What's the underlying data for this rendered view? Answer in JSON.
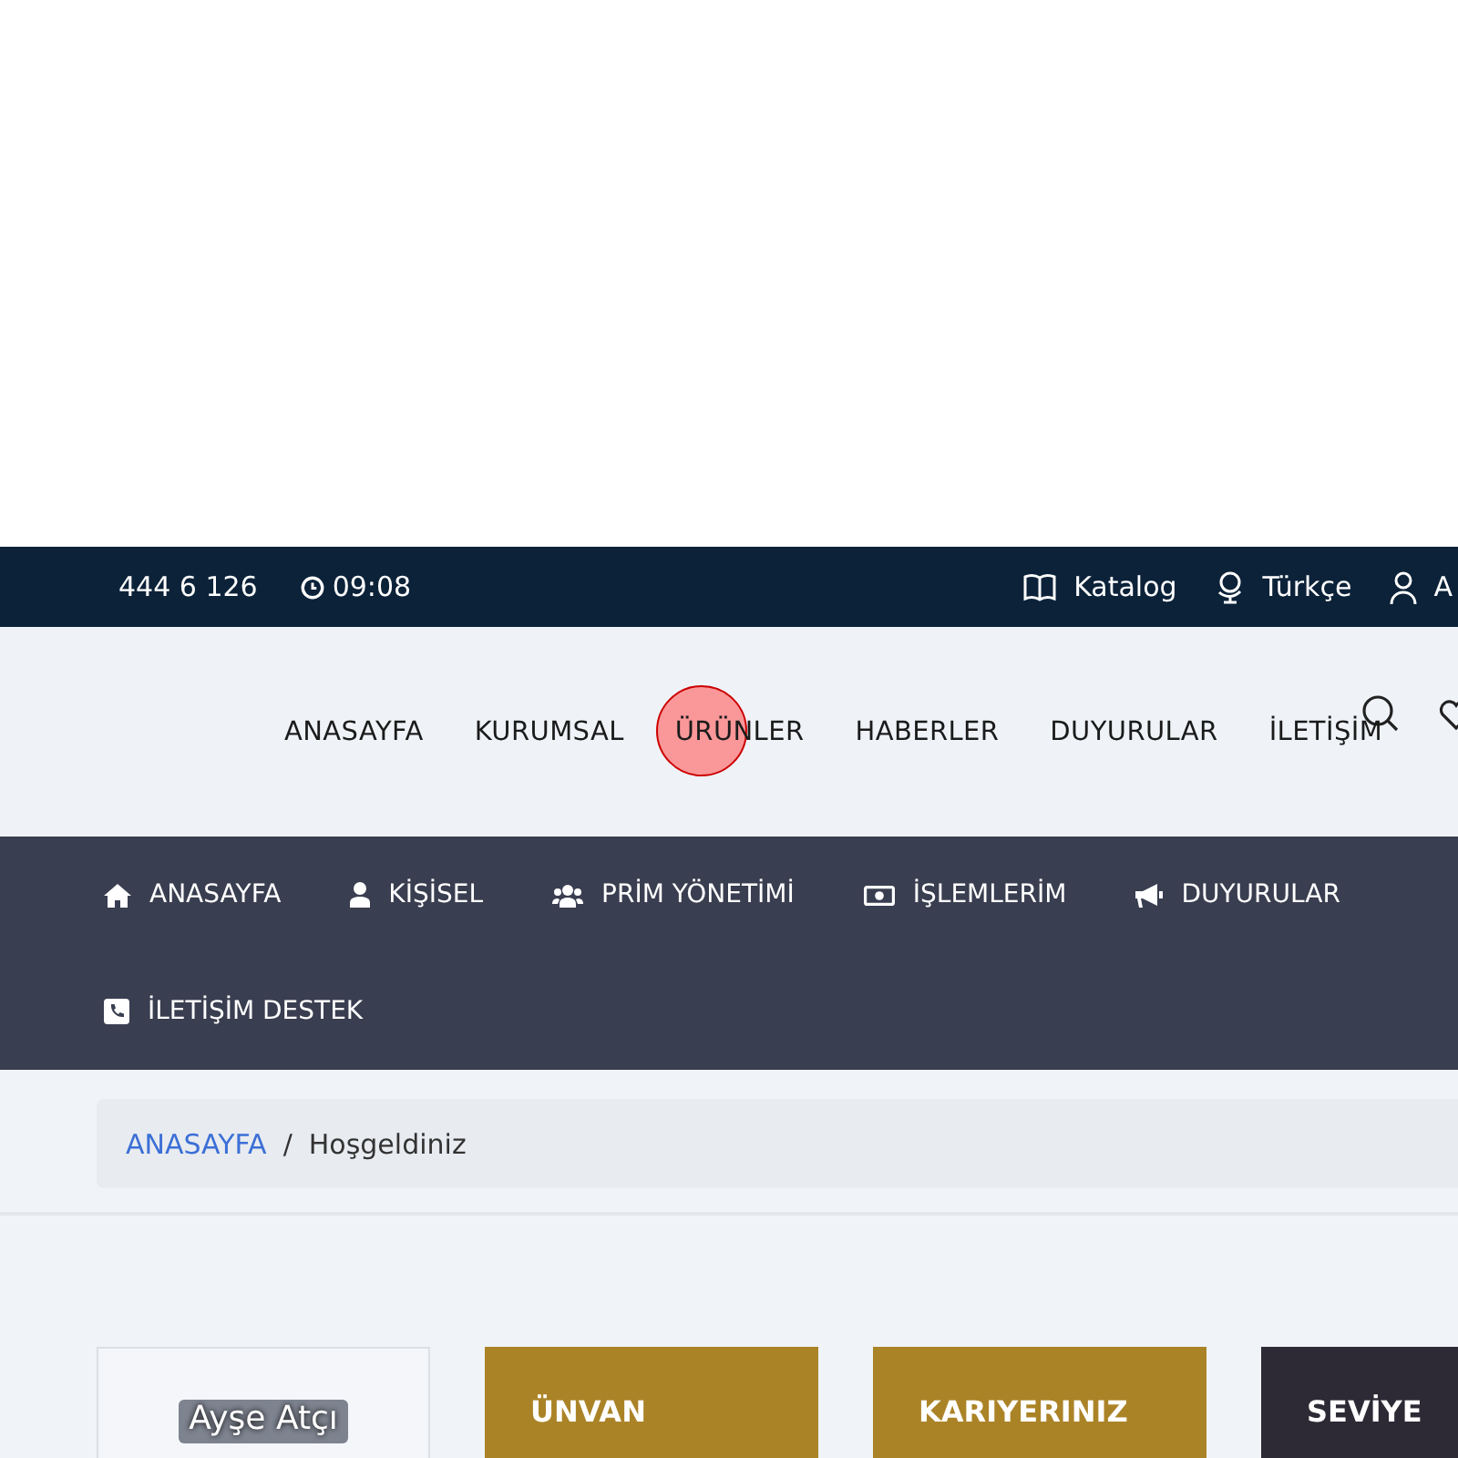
{
  "top_bar": {
    "phone": "444 6 126",
    "time": "09:08",
    "links": [
      {
        "kind": "book",
        "label": "Katalog"
      },
      {
        "kind": "globe",
        "label": "Türkçe"
      },
      {
        "kind": "user",
        "label": "A"
      }
    ]
  },
  "main_nav": {
    "items": [
      {
        "label": "ANASAYFA",
        "tapped": false
      },
      {
        "label": "KURUMSAL",
        "tapped": false
      },
      {
        "label": "ÜRÜNLER",
        "tapped": true
      },
      {
        "label": "HABERLER",
        "tapped": false
      },
      {
        "label": "DUYURULAR",
        "tapped": false
      },
      {
        "label": "İLETİŞİM",
        "tapped": false
      }
    ]
  },
  "member_menu": {
    "items": [
      {
        "kind": "home",
        "label": "ANASAYFA"
      },
      {
        "kind": "user",
        "label": "KİŞİSEL"
      },
      {
        "kind": "users",
        "label": "PRİM YÖNETİMİ"
      },
      {
        "kind": "money",
        "label": "İŞLEMLERİM"
      },
      {
        "kind": "megaphone",
        "label": "DUYURULAR"
      },
      {
        "kind": "phone",
        "label": "İLETİŞİM DESTEK"
      }
    ]
  },
  "breadcrumb": {
    "separator": "/",
    "items": [
      "ANASAYFA",
      "Hoşgeldiniz"
    ]
  },
  "cards": [
    {
      "kind": "profile",
      "title": "Ayşe Atçı"
    },
    {
      "kind": "gold",
      "title": "ÜNVAN"
    },
    {
      "kind": "gold",
      "title": "KARIYERINIZ"
    },
    {
      "kind": "dark",
      "title": "SEVİYE"
    }
  ]
}
